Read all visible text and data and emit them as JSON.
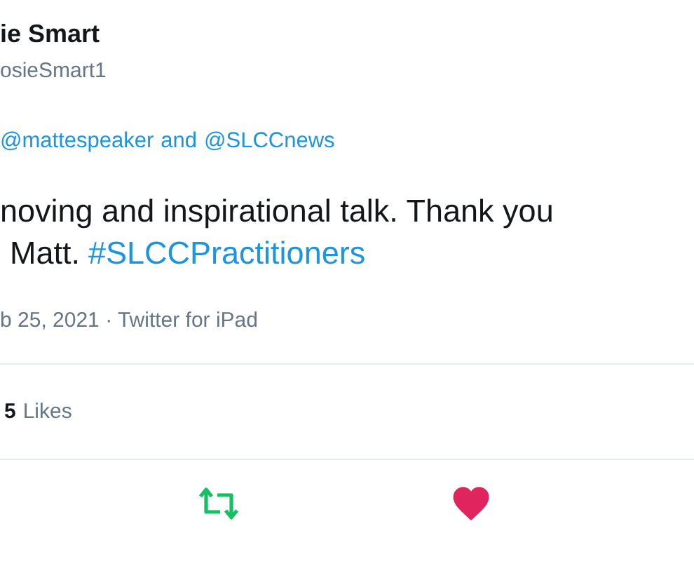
{
  "author": {
    "name": "ie Smart",
    "handle": "osieSmart1"
  },
  "reply_to": {
    "mentions": [
      "@mattespeaker",
      "@SLCCnews"
    ],
    "joiner": "and"
  },
  "body": {
    "lines": [
      {
        "text": "noving and inspirational talk. Thank you"
      },
      {
        "text": "Matt.",
        "hashtag": "#SLCCPractitioners"
      }
    ]
  },
  "meta": "b 25, 2021 · Twitter for iPad",
  "stats": {
    "count": "5",
    "label": "Likes"
  },
  "actions": [
    {
      "kind": "retweet",
      "selected": true
    },
    {
      "kind": "like",
      "selected": true
    }
  ]
}
